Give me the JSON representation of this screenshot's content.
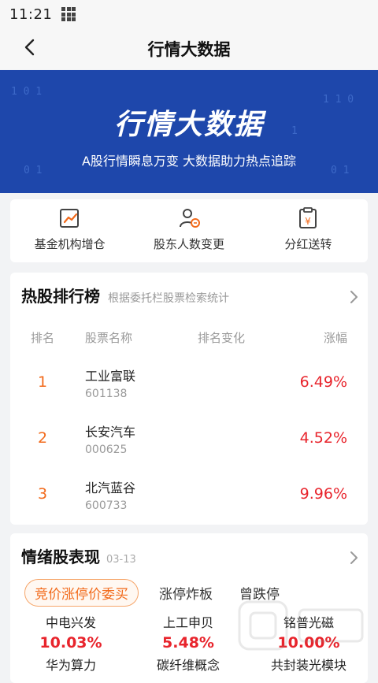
{
  "status": {
    "time": "11:21"
  },
  "nav": {
    "title": "行情大数据"
  },
  "banner": {
    "title": "行情大数据",
    "subtitle": "A股行情瞬息万变 大数据助力热点追踪"
  },
  "shortcuts": [
    {
      "label": "基金机构增仓",
      "icon": "chart-up-icon"
    },
    {
      "label": "股东人数变更",
      "icon": "user-refresh-icon"
    },
    {
      "label": "分红送转",
      "icon": "yen-clipboard-icon"
    }
  ],
  "hot": {
    "title": "热股排行榜",
    "subtitle": "根据委托栏股票检索统计",
    "headers": {
      "rank": "排名",
      "name": "股票名称",
      "change": "排名变化",
      "pct": "涨幅"
    },
    "rows": [
      {
        "rank": "1",
        "name": "工业富联",
        "code": "601138",
        "pct": "6.49%"
      },
      {
        "rank": "2",
        "name": "长安汽车",
        "code": "000625",
        "pct": "4.52%"
      },
      {
        "rank": "3",
        "name": "北汽蓝谷",
        "code": "600733",
        "pct": "9.96%"
      }
    ]
  },
  "emotion": {
    "title": "情绪股表现",
    "date": "03-13",
    "tabs": [
      "竞价涨停价委买",
      "涨停炸板",
      "曾跌停"
    ],
    "cols": [
      {
        "name": "中电兴发",
        "pct": "10.03%",
        "sub": "华为算力"
      },
      {
        "name": "上工申贝",
        "pct": "5.48%",
        "sub": "碳纤维概念"
      },
      {
        "name": "铭普光磁",
        "pct": "10.00%",
        "sub": "共封装光模块"
      }
    ]
  },
  "colors": {
    "accent": "#f26a1b",
    "up": "#e8242c",
    "banner": "#1e47ab"
  }
}
